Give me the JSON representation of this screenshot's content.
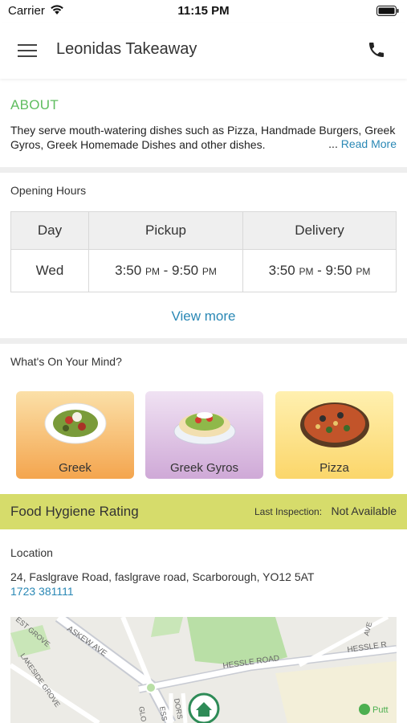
{
  "status_bar": {
    "carrier": "Carrier",
    "time": "11:15 PM"
  },
  "nav": {
    "title": "Leonidas Takeaway",
    "menu_icon": "hamburger-menu-icon",
    "phone_icon": "phone-icon"
  },
  "about": {
    "title": "ABOUT",
    "text": "They serve mouth-watering dishes such as Pizza, Handmade Burgers, Greek Gyros, Greek Homemade Dishes and other dishes.",
    "ellipsis": "...",
    "read_more": "Read More"
  },
  "opening_hours": {
    "title": "Opening Hours",
    "headers": [
      "Day",
      "Pickup",
      "Delivery"
    ],
    "row": {
      "day": "Wed",
      "pickup_start": "3:50",
      "pickup_start_period": "PM",
      "pickup_sep": " - ",
      "pickup_end": "9:50",
      "pickup_end_period": "PM",
      "delivery_start": "3:50",
      "delivery_start_period": "PM",
      "delivery_sep": " - ",
      "delivery_end": "9:50",
      "delivery_end_period": "PM"
    },
    "view_more": "View more"
  },
  "mind": {
    "title": "What's On Your Mind?",
    "categories": [
      {
        "label": "Greek"
      },
      {
        "label": "Greek Gyros"
      },
      {
        "label": "Pizza"
      }
    ]
  },
  "hygiene": {
    "title": "Food Hygiene Rating",
    "inspection_label": "Last Inspection:",
    "inspection_value": "Not Available"
  },
  "location": {
    "title": "Location",
    "address": "24, Faslgrave Road, faslgrave road, Scarborough, YO12 5AT",
    "phone": "1723 381111",
    "map": {
      "streets": [
        "ASKEW AVE",
        "HESSLE ROAD",
        "HESSLE R",
        "LAKESIDE GROVE",
        "EST GROVE",
        "AVE",
        "GLO",
        "ESS",
        "DORS",
        "Putt"
      ]
    }
  },
  "colors": {
    "accent_green": "#5fbd5f",
    "link_blue": "#2a88b5",
    "hygiene_band": "#d6dc6b"
  }
}
